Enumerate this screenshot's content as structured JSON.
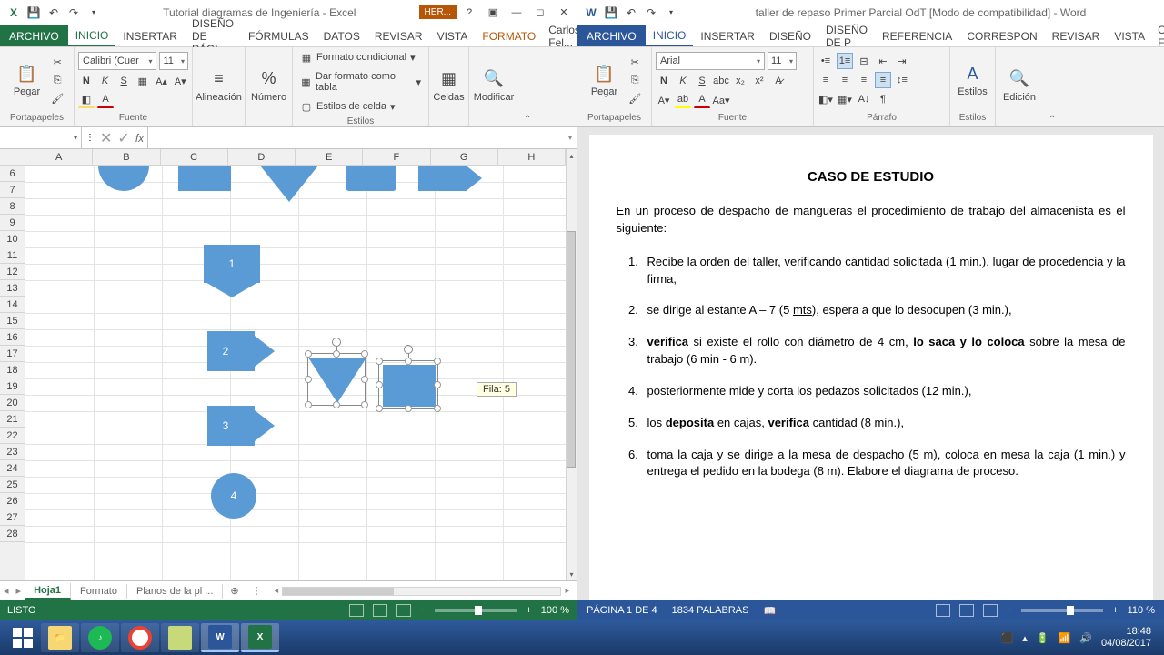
{
  "excel": {
    "title": "Tutorial diagramas de Ingeniería - Excel",
    "contextual_tab": "HER...",
    "tabs": {
      "file": "ARCHIVO",
      "home": "INICIO",
      "insert": "INSERTAR",
      "layout": "DISEÑO DE PÁGI",
      "formulas": "FÓRMULAS",
      "data": "DATOS",
      "review": "REVISAR",
      "view": "VISTA",
      "format": "FORMATO"
    },
    "user": "Carlos Fel...",
    "ribbon": {
      "clipboard": "Portapapeles",
      "paste": "Pegar",
      "font_group": "Fuente",
      "font_name": "Calibri (Cuer",
      "font_size": "11",
      "align_group": "Alineación",
      "align": "Alineación",
      "number_group": "Número",
      "number": "Número",
      "styles_group": "Estilos",
      "cond_fmt": "Formato condicional",
      "table_fmt": "Dar formato como tabla",
      "cell_styles": "Estilos de celda",
      "cells": "Celdas",
      "edit": "Modificar"
    },
    "columns": [
      "A",
      "B",
      "C",
      "D",
      "E",
      "F",
      "G",
      "H"
    ],
    "rows": [
      "6",
      "7",
      "8",
      "9",
      "10",
      "11",
      "12",
      "13",
      "14",
      "15",
      "16",
      "17",
      "18",
      "19",
      "20",
      "21",
      "22",
      "23",
      "24",
      "25",
      "26",
      "27",
      "28"
    ],
    "shape_labels": {
      "s1": "1",
      "s2": "2",
      "s3": "3",
      "s4": "4"
    },
    "tooltip": "Fila: 5",
    "sheets": {
      "hoja1": "Hoja1",
      "formato": "Formato",
      "planos": "Planos de la pl  ..."
    },
    "status": {
      "ready": "LISTO",
      "zoom": "100 %"
    }
  },
  "word": {
    "title": "taller de repaso Primer Parcial OdT [Modo de compatibilidad] - Word",
    "tabs": {
      "file": "ARCHIVO",
      "home": "INICIO",
      "insert": "INSERTAR",
      "design": "DISEÑO",
      "layout": "DISEÑO DE P",
      "references": "REFERENCIA",
      "mail": "CORRESPON",
      "review": "REVISAR",
      "view": "VISTA"
    },
    "user": "Carlos Fel...",
    "ribbon": {
      "clipboard": "Portapapeles",
      "paste": "Pegar",
      "font_group": "Fuente",
      "font_name": "Arial",
      "font_size": "11",
      "para": "Párrafo",
      "styles": "Estilos",
      "edit": "Edición"
    },
    "doc": {
      "title": "CASO DE ESTUDIO",
      "intro": "En un proceso de despacho de mangueras el procedimiento de trabajo del almacenista es el siguiente:",
      "items": [
        {
          "pre": "Recibe la orden del taller, verificando cantidad solicitada (1 min.), lugar de procedencia y la firma,",
          "bold": "",
          "post": ""
        },
        {
          "pre": "se dirige al estante A – 7 (5 ",
          "u": "mts",
          "pre2": "), espera a que lo desocupen (3 min.),"
        },
        {
          "b1": "verifica",
          "mid": " si existe el rollo con diámetro de 4 cm, ",
          "b2": "lo saca y lo coloca",
          "post": " sobre la mesa de trabajo (6 min - 6 m)."
        },
        {
          "pre": "posteriormente mide y corta los pedazos solicitados (12 min.),"
        },
        {
          "pre": "los ",
          "b1": "deposita",
          "mid": " en cajas, ",
          "b2": "verifica",
          "post": " cantidad (8 min.),"
        },
        {
          "pre": "toma la caja y se dirige a la mesa de despacho (5 m), coloca en mesa la caja (1 min.) y entrega el pedido en la bodega (8 m). Elabore el diagrama de proceso."
        }
      ]
    },
    "status": {
      "page": "PÁGINA 1 DE 4",
      "words": "1834 PALABRAS",
      "zoom": "110 %"
    }
  },
  "taskbar": {
    "time": "18:48",
    "date": "04/08/2017"
  }
}
